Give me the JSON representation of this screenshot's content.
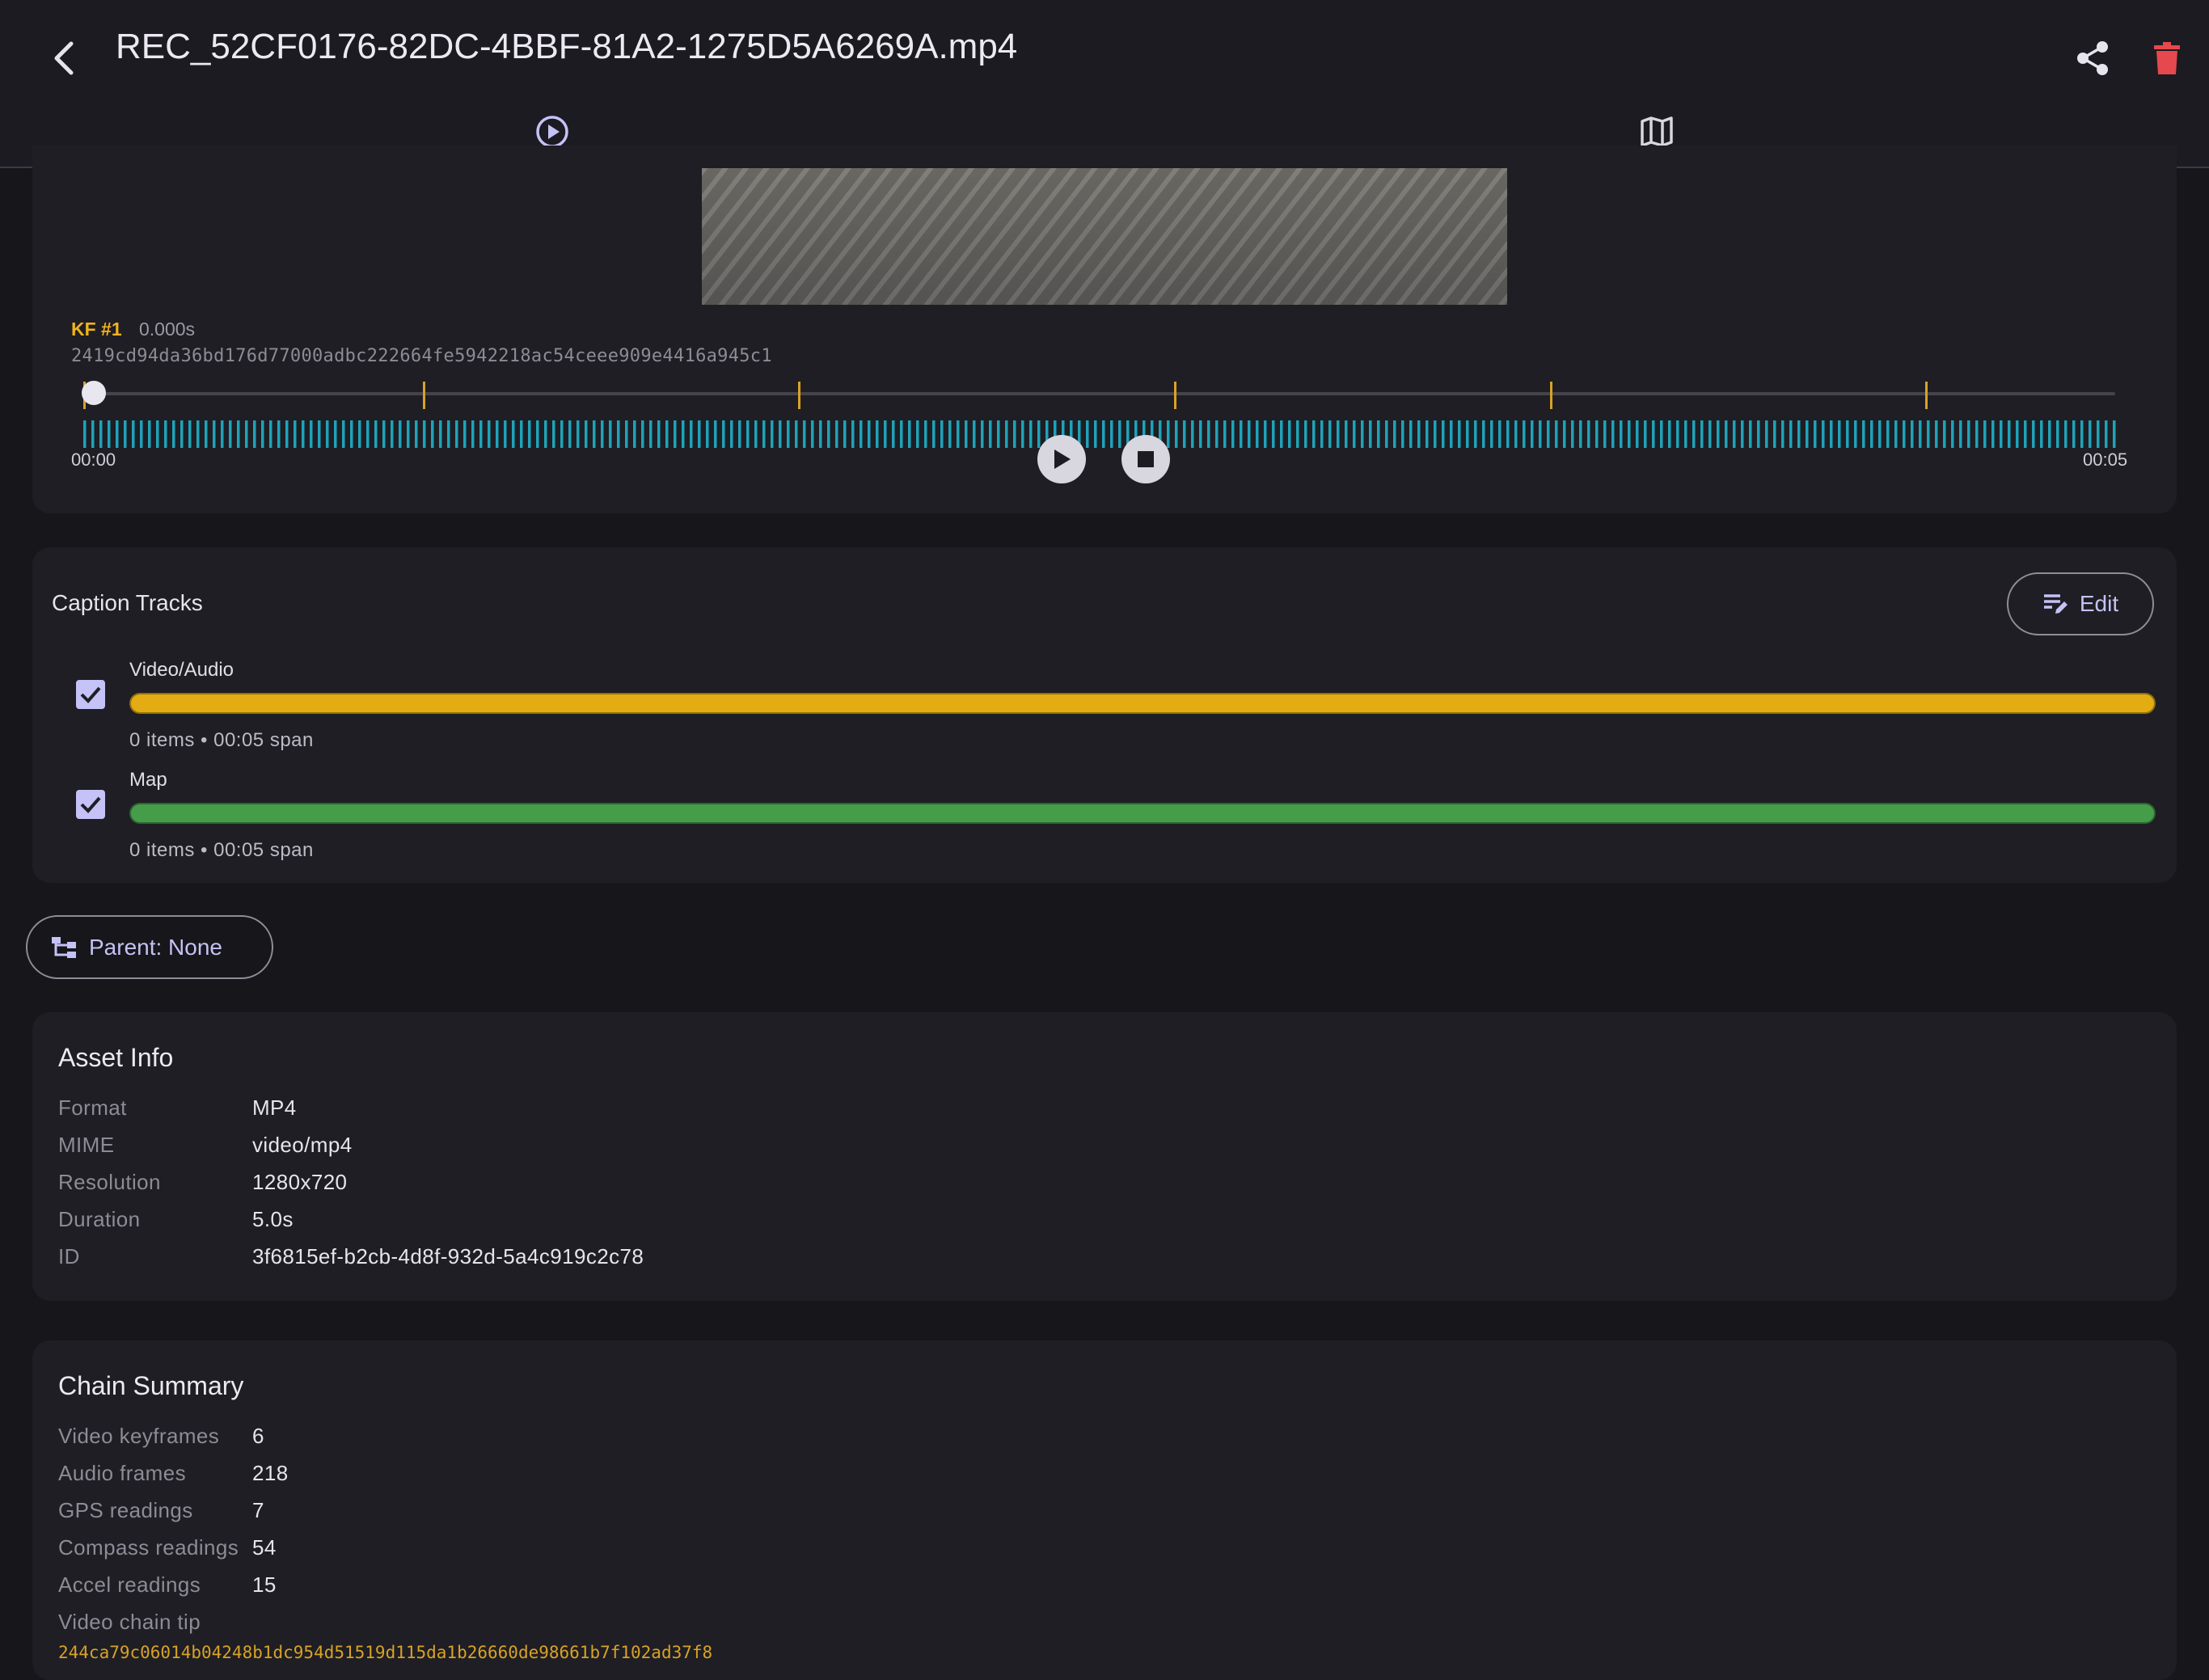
{
  "header": {
    "title": "REC_52CF0176-82DC-4BBF-81A2-1275D5A6269A.mp4",
    "back_icon": "chevron-left-icon",
    "share_icon": "share-icon",
    "delete_icon": "trash-icon",
    "delete_color": "#e5484d"
  },
  "tabs": [
    {
      "icon": "play-circle-icon",
      "selected": true
    },
    {
      "icon": "map-icon",
      "selected": false
    }
  ],
  "player": {
    "keyframe_label": "KF #1",
    "keyframe_time": "0.000s",
    "keyframe_hash": "2419cd94da36bd176d77000adbc222664fe5942218ac54ceee909e4416a945c1",
    "time_start": "00:00",
    "time_end": "00:05",
    "position_fraction": 0.0,
    "keyframe_tick_fractions": [
      0.0,
      0.167,
      0.352,
      0.537,
      0.722,
      0.907
    ],
    "accent_color": "#d9a227",
    "waveform_color": "#1fa3b8"
  },
  "caption_tracks": {
    "title": "Caption Tracks",
    "edit_label": "Edit",
    "tracks": [
      {
        "name": "Video/Audio",
        "checked": true,
        "color": "#e2ac12",
        "meta": "0 items • 00:05 span"
      },
      {
        "name": "Map",
        "checked": true,
        "color": "#459d4a",
        "meta": "0 items • 00:05 span"
      }
    ]
  },
  "parent": {
    "label": "Parent: None",
    "icon": "hierarchy-icon"
  },
  "asset_info": {
    "title": "Asset Info",
    "rows": [
      {
        "key": "Format",
        "value": "MP4"
      },
      {
        "key": "MIME",
        "value": "video/mp4"
      },
      {
        "key": "Resolution",
        "value": "1280x720"
      },
      {
        "key": "Duration",
        "value": "5.0s"
      },
      {
        "key": "ID",
        "value": "3f6815ef-b2cb-4d8f-932d-5a4c919c2c78"
      }
    ]
  },
  "chain_summary": {
    "title": "Chain Summary",
    "rows": [
      {
        "key": "Video keyframes",
        "value": "6"
      },
      {
        "key": "Audio frames",
        "value": "218"
      },
      {
        "key": "GPS readings",
        "value": "7"
      },
      {
        "key": "Compass readings",
        "value": "54"
      },
      {
        "key": "Accel readings",
        "value": "15"
      },
      {
        "key": "Video chain tip",
        "value": ""
      }
    ],
    "chain_tip": "244ca79c06014b04248b1dc954d51519d115da1b26660de98661b7f102ad37f8"
  }
}
